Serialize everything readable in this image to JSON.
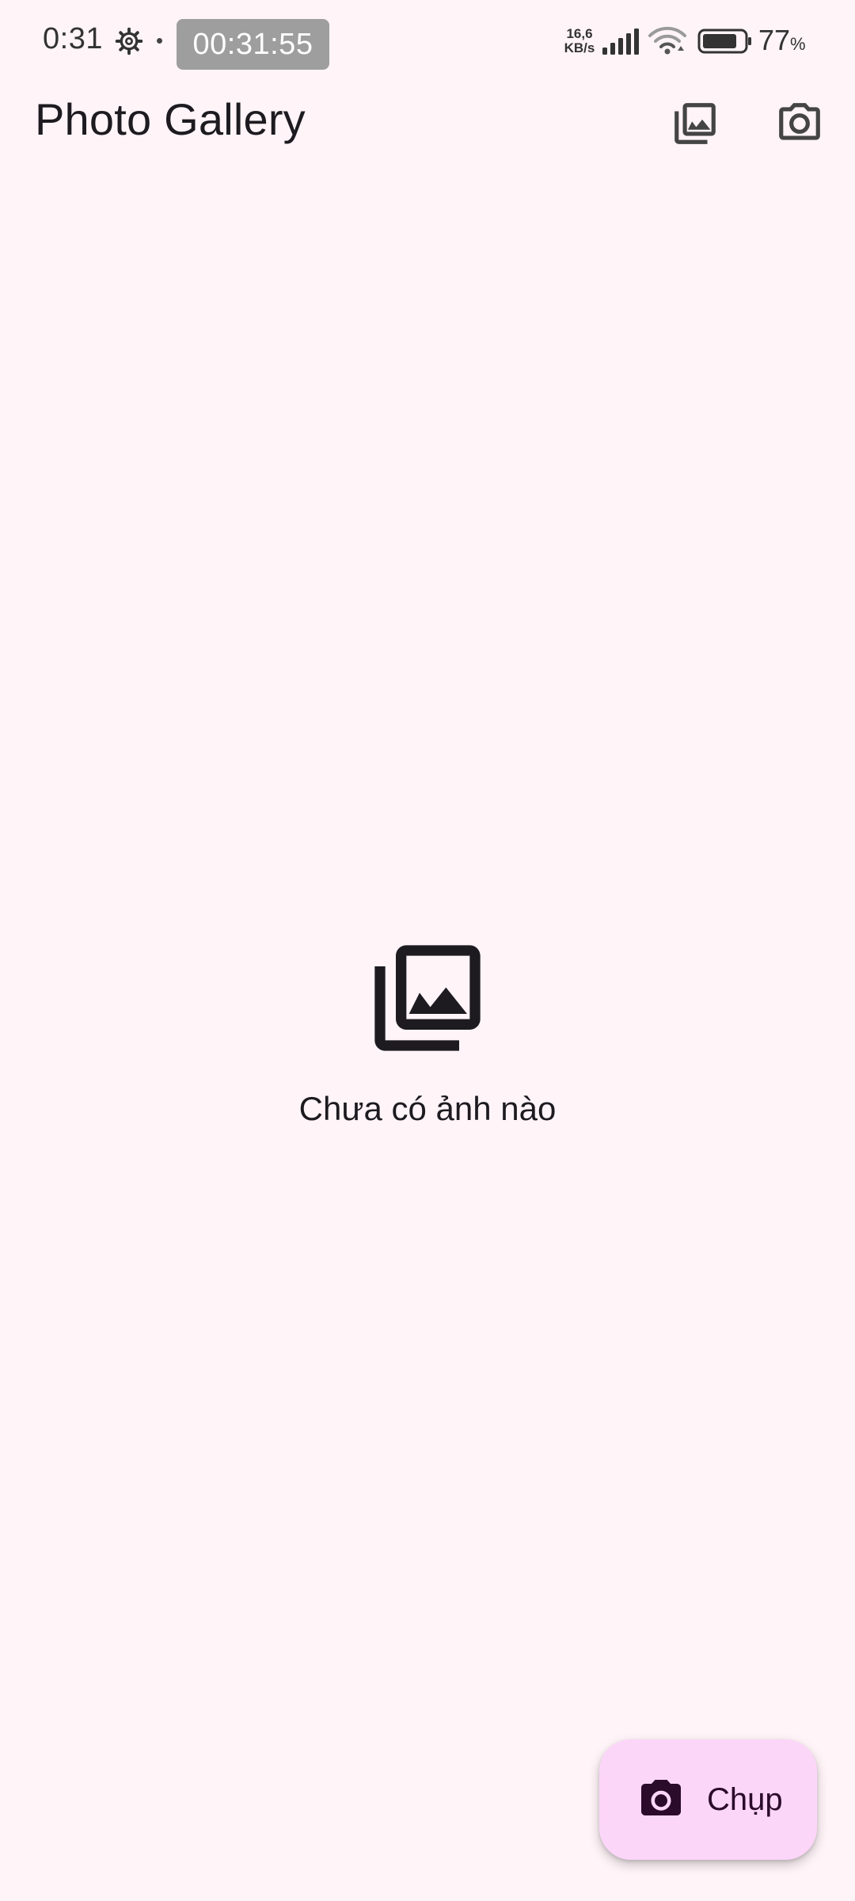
{
  "status_bar": {
    "time": "0:31",
    "recorder_time": "00:31:55",
    "speed_value": "16,6",
    "speed_unit": "KB/s",
    "battery_percent": "77",
    "battery_percent_symbol": "%",
    "icons": [
      "settings-gear-icon",
      "signal-bars-icon",
      "wifi-icon",
      "battery-icon"
    ]
  },
  "app_bar": {
    "title": "Photo Gallery",
    "actions": [
      "photo-library-icon",
      "camera-icon"
    ]
  },
  "empty_state": {
    "icon": "photo-library-icon",
    "message": "Chưa có ảnh nào"
  },
  "fab": {
    "icon": "camera-icon",
    "label": "Chụp"
  },
  "colors": {
    "background": "#fff4f8",
    "fab_background": "#fcd6f9",
    "on_surface": "#1d1b20",
    "fab_content": "#2a0b2a"
  }
}
